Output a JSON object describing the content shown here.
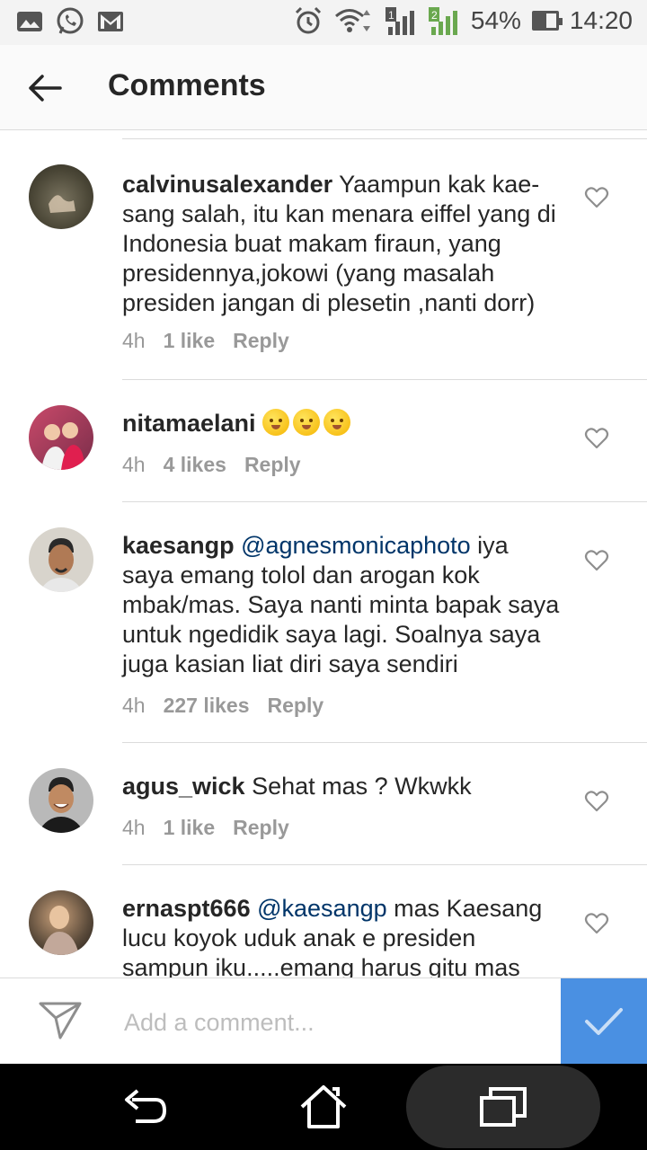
{
  "status_bar": {
    "battery": "54%",
    "time": "14:20",
    "battery_level": 0.54,
    "left_icons": [
      "gallery-icon",
      "whatsapp-icon",
      "gmail-icon"
    ],
    "right_icons": [
      "alarm-icon",
      "wifi-icon",
      "signal-1-icon",
      "signal-2-icon",
      "battery-icon"
    ]
  },
  "header": {
    "title": "Comments"
  },
  "comments": [
    {
      "username": "calvinusalexander",
      "mention": "",
      "text": "Yaampun kak kae-sang salah, itu kan menara eiffel yang di Indonesia buat makam firaun, yang presidennya,jokowi (yang masalah presiden jangan di plesetin ,nanti dorr)",
      "time": "4h",
      "likes": "1 like",
      "reply": "Reply"
    },
    {
      "username": "nitamaelani",
      "mention": "",
      "text": "",
      "emoji_count": 3,
      "time": "4h",
      "likes": "4 likes",
      "reply": "Reply"
    },
    {
      "username": "kaesangp",
      "mention": "@agnesmonicaphoto",
      "text": "iya saya emang tolol dan arogan kok mbak/mas. Saya nanti minta bapak saya untuk ngedidik saya lagi. Soalnya saya juga kasian liat diri saya sendiri",
      "time": "4h",
      "likes": "227 likes",
      "reply": "Reply"
    },
    {
      "username": "agus_wick",
      "mention": "",
      "text": "Sehat mas ? Wkwkk",
      "time": "4h",
      "likes": "1 like",
      "reply": "Reply"
    },
    {
      "username": "ernaspt666",
      "mention": "@kaesangp",
      "text": "mas Kaesang lucu koyok uduk anak e presiden sampun iku.....emang harus gitu mas",
      "time": "",
      "likes": "",
      "reply": ""
    }
  ],
  "add_comment": {
    "placeholder": "Add a comment..."
  },
  "colors": {
    "accent": "#4a90e2",
    "mention": "#003569",
    "meta": "#999999"
  }
}
